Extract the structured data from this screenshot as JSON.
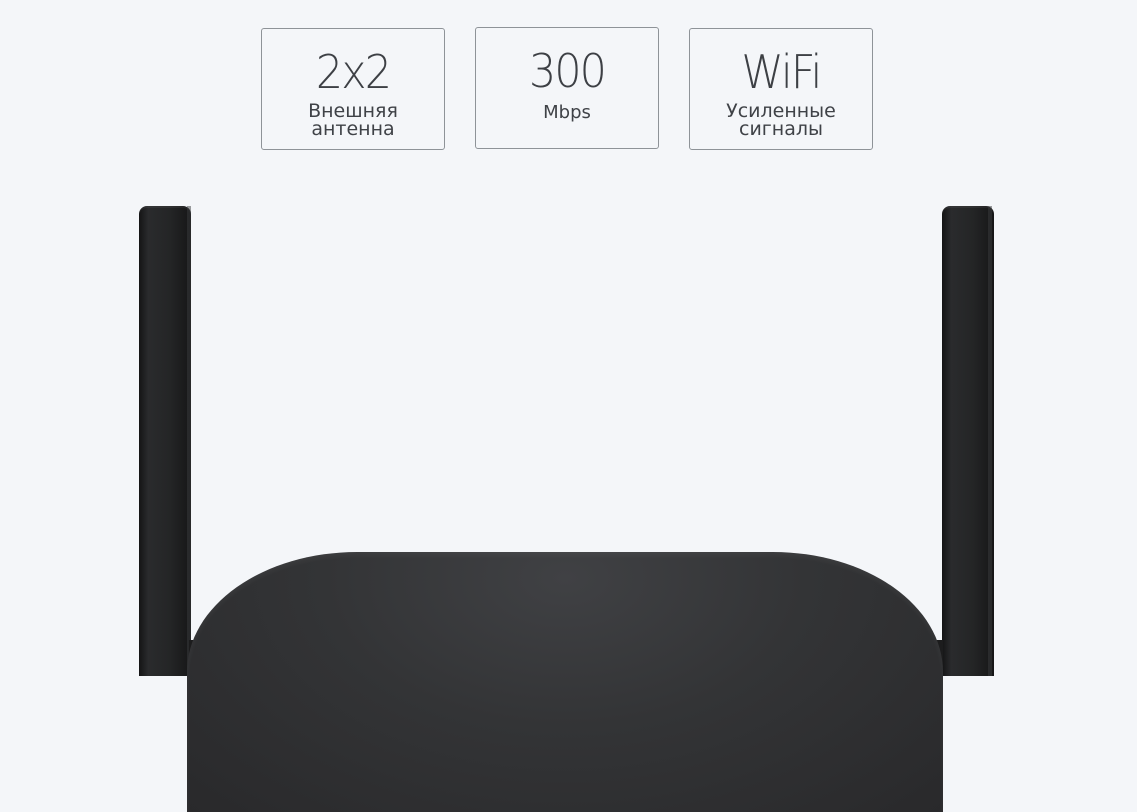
{
  "features": [
    {
      "value": "2x2",
      "label": "Внешняя\nантенна"
    },
    {
      "value": "300",
      "label": "Mbps"
    },
    {
      "value": "WiFi",
      "label": "Усиленные\nсигналы"
    }
  ],
  "colors": {
    "background": "#f4f6f9",
    "device": "#2b2c2e",
    "card_border": "#8e9398",
    "text": "#3f4247"
  }
}
